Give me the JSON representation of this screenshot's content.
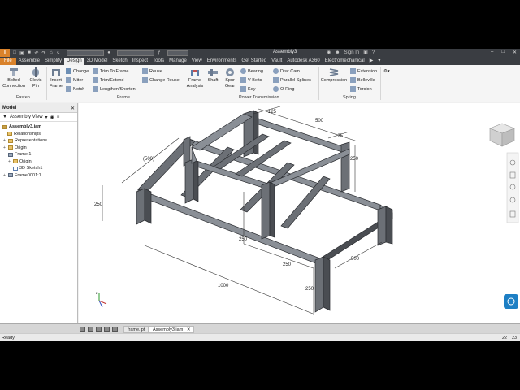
{
  "app": {
    "logo": "I",
    "title": "Assembly3",
    "search_icon": "binoculars-icon",
    "sign_in": "Sign In",
    "help_icon": "question-icon",
    "window_controls": [
      "–",
      "□",
      "✕"
    ]
  },
  "tabs": [
    "File",
    "Assemble",
    "Simplify",
    "Design",
    "3D Model",
    "Sketch",
    "Inspect",
    "Tools",
    "Manage",
    "View",
    "Environments",
    "Get Started",
    "Vault",
    "Autodesk A360",
    "Electromechanical"
  ],
  "active_tab": "Design",
  "ribbon": {
    "fasten": {
      "label": "Fasten",
      "bolted": [
        "Bolted",
        "Connection"
      ],
      "clevis": [
        "Clevis",
        "Pin"
      ]
    },
    "frame": {
      "label": "Frame",
      "insert": [
        "Insert",
        "Frame"
      ],
      "change": "Change",
      "miter": "Miter",
      "notch": "Notch",
      "trim_to_frame": "Trim To Frame",
      "trim_extend": "Trim/Extend",
      "lengthen_shorten": "Lengthen/Shorten",
      "reuse": "Reuse",
      "change_reuse": "Change Reuse",
      "frame_analysis": [
        "Frame",
        "Analysis"
      ]
    },
    "power": {
      "label": "Power Transmission",
      "shaft": "Shaft",
      "spur_gear": [
        "Spur",
        "Gear"
      ],
      "bearing": "Bearing",
      "vbelts": "V-Belts",
      "key": "Key",
      "disc_cam": "Disc Cam",
      "parallel_splines": "Parallel Splines",
      "oring": "O-Ring"
    },
    "spring": {
      "label": "Spring",
      "compression": "Compression",
      "extension": "Extension",
      "belleville": "Belleville",
      "torsion": "Torsion"
    }
  },
  "browser": {
    "title": "Model",
    "view": "Assembly View",
    "items": [
      {
        "label": "Assembly3.iam",
        "level": 0,
        "bold": true
      },
      {
        "label": "Relationships",
        "level": 1
      },
      {
        "label": "Representations",
        "level": 1
      },
      {
        "label": "Origin",
        "level": 1
      },
      {
        "label": "Frame 1",
        "level": 1
      },
      {
        "label": "Origin",
        "level": 2
      },
      {
        "label": "3D Sketch1",
        "level": 2
      },
      {
        "label": "Frame0001:1",
        "level": 1
      }
    ]
  },
  "dimensions": {
    "top_width": "500",
    "top_left": "125",
    "top_right": "125",
    "left_depth": "(500)",
    "upper_height": "250",
    "lower_height_left": "250",
    "front_length": "1000",
    "right_depth": "500",
    "mid_width": "250",
    "right_height": "250",
    "back_height": "250"
  },
  "doc_tabs": [
    "frame.ipt",
    "Assembly3.iam"
  ],
  "active_doc": "Assembly3.iam",
  "status": {
    "left": "Ready",
    "n1": "22",
    "n2": "23"
  }
}
